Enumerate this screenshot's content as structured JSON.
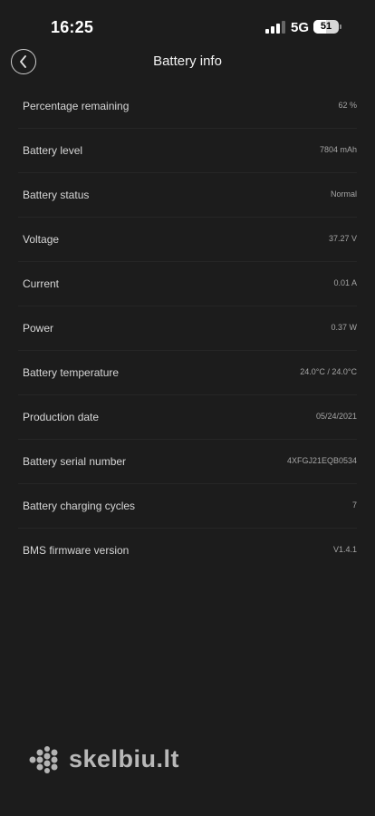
{
  "status_bar": {
    "time": "16:25",
    "network": "5G",
    "battery_percent": "51",
    "battery_fraction": 0.51
  },
  "header": {
    "title": "Battery info"
  },
  "info_rows": [
    {
      "label": "Percentage remaining",
      "value": "62 %"
    },
    {
      "label": "Battery level",
      "value": "7804 mAh"
    },
    {
      "label": "Battery status",
      "value": "Normal"
    },
    {
      "label": "Voltage",
      "value": "37.27 V"
    },
    {
      "label": "Current",
      "value": "0.01 A"
    },
    {
      "label": "Power",
      "value": "0.37 W"
    },
    {
      "label": "Battery temperature",
      "value": "24.0°C / 24.0°C"
    },
    {
      "label": "Production date",
      "value": "05/24/2021"
    },
    {
      "label": "Battery serial number",
      "value": "4XFGJ21EQB0534"
    },
    {
      "label": "Battery charging cycles",
      "value": "7"
    },
    {
      "label": "BMS firmware version",
      "value": "V1.4.1"
    }
  ],
  "watermark": {
    "text": "skelbiu.lt"
  }
}
